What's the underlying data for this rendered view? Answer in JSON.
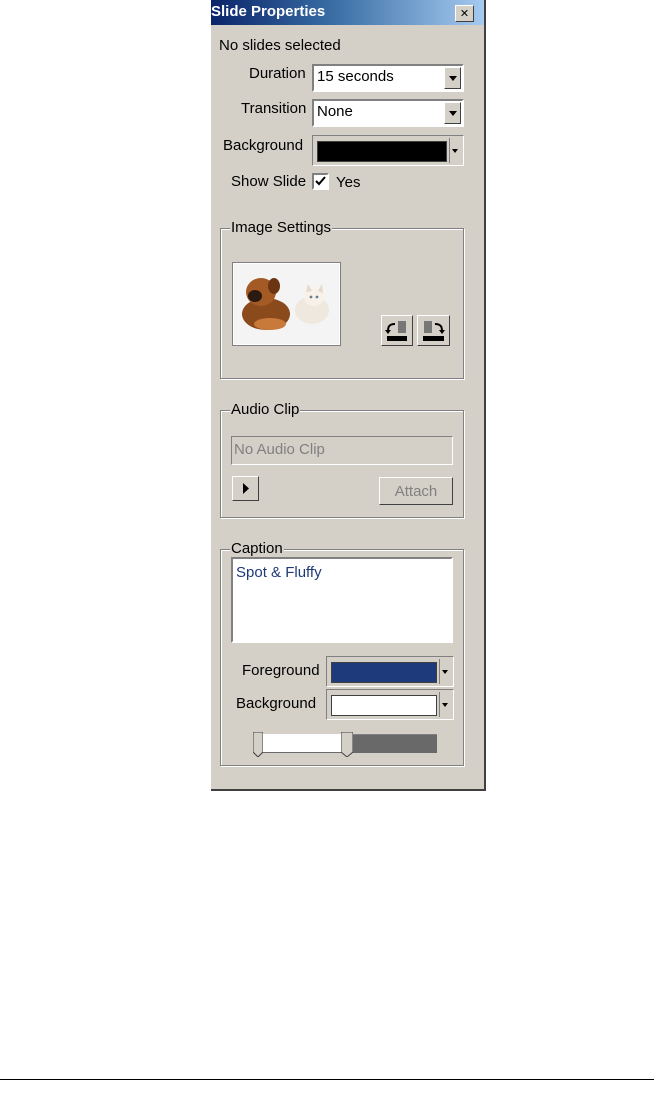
{
  "window": {
    "title": "Slide Properties",
    "close_glyph": "✕"
  },
  "status": {
    "text": "No slides selected"
  },
  "fields": {
    "duration": {
      "label": "Duration",
      "value": "15 seconds"
    },
    "transition": {
      "label": "Transition",
      "value": "None"
    },
    "background": {
      "label": "Background",
      "color": "#000000"
    },
    "show_slide": {
      "label": "Show Slide",
      "checked": true,
      "option_label": "Yes"
    }
  },
  "image_settings": {
    "legend": "Image Settings",
    "thumbnail_icon": "dog-and-cat-photo-icon",
    "rotate_left_icon": "rotate-left-icon",
    "rotate_right_icon": "rotate-right-icon"
  },
  "audio_clip": {
    "legend": "Audio Clip",
    "field_value": "No Audio Clip",
    "play_icon": "play-icon",
    "attach_label": "Attach"
  },
  "caption": {
    "legend": "Caption",
    "text": "Spot & Fluffy",
    "foreground_label": "Foreground",
    "foreground_color": "#1f3a7a",
    "background_label": "Background",
    "background_color": "#ffffff",
    "slider_level": 0.5
  }
}
